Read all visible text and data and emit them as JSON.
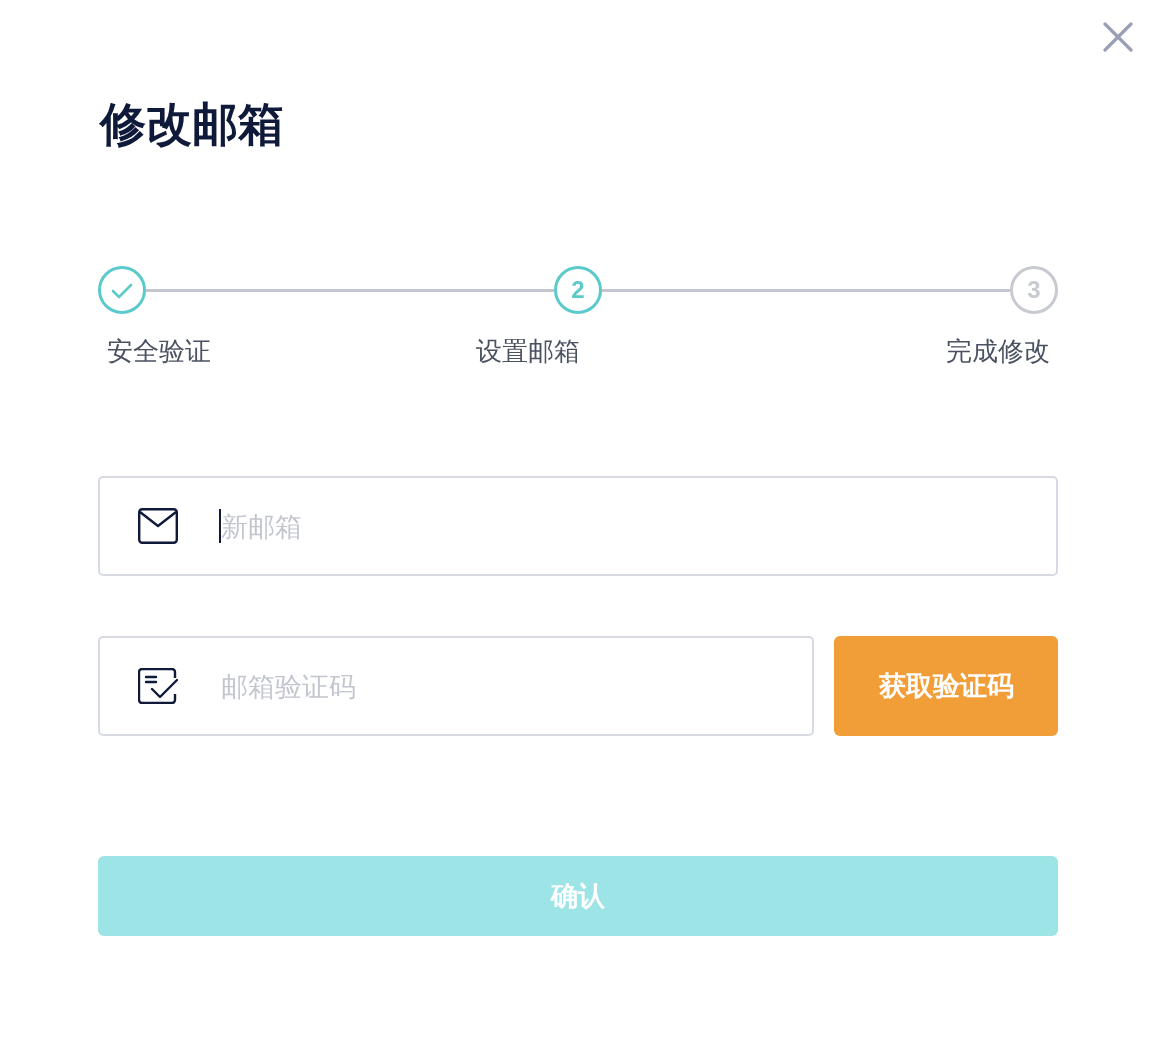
{
  "dialog": {
    "title": "修改邮箱"
  },
  "steps": [
    {
      "label": "安全验证",
      "done": true
    },
    {
      "label": "设置邮箱",
      "number": "2",
      "done": false
    },
    {
      "label": "完成修改",
      "number": "3",
      "done": false
    }
  ],
  "fields": [
    {
      "kind": "email",
      "placeholder": "新邮箱",
      "focused": true
    },
    {
      "kind": "code",
      "placeholder": "邮箱验证码",
      "focused": false
    }
  ],
  "send_code_button": {
    "label": "获取验证码"
  },
  "confirm_button": {
    "label": "确认",
    "disabled": true
  }
}
